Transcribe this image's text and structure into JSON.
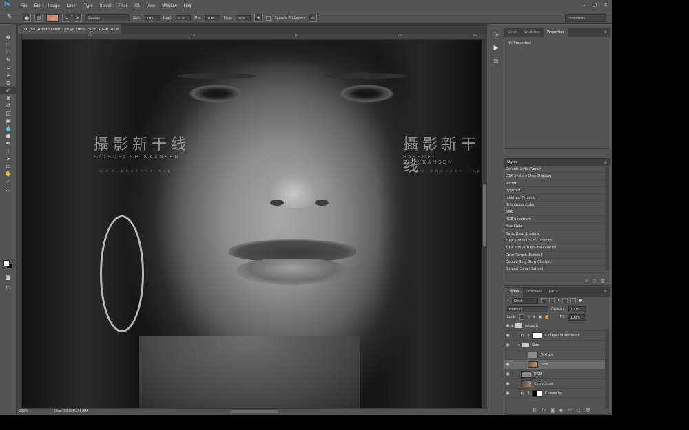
{
  "menubar": {
    "logo": "Ps",
    "items": [
      "File",
      "Edit",
      "Image",
      "Layer",
      "Type",
      "Select",
      "Filter",
      "3D",
      "View",
      "Window",
      "Help"
    ],
    "window_controls": [
      "–",
      "▢",
      "✕"
    ]
  },
  "options": {
    "preset": "Custom",
    "soft_label": "Soft:",
    "soft_value": "10%",
    "load_label": "Load:",
    "load_value": "10%",
    "mix_label": "Mix:",
    "mix_value": "10%",
    "flow_label": "Flow:",
    "flow_value": "10%",
    "sample_all_layers": "Sample All Layers",
    "workspace": "Essentials"
  },
  "document": {
    "tab_title": "DSC_8574-Mod-Filter 2.tif @ 200% (Skin, RGB/16) *",
    "tab_close": "×",
    "ruler_marks": [
      "20",
      "10",
      "10",
      "20",
      "60"
    ],
    "status_zoom": "200%",
    "status_doc": "Doc: 33.8M/136.8M"
  },
  "watermark": {
    "chinese": "攝影新干线",
    "english": "SATSUEI SHINKANSEN",
    "url": "www.photoss.vip"
  },
  "properties_panel": {
    "tabs": [
      "Color",
      "Swatches",
      "Properties"
    ],
    "active_tab": "Properties",
    "empty_text": "No Properties"
  },
  "styles_panel": {
    "title": "Styles",
    "items": [
      "Default Style (None)",
      "OSX System Drop Shadow",
      "Button",
      "Pyramid",
      "Inverted Pyramid",
      "Brightness Cube",
      "RGB",
      "RGB Spectrum",
      "Hue Cube",
      "Basic Drop Shadow",
      "1 Px Stroke 0% Fill Opacity",
      "1 Px Stroke 100% Fill Opacity",
      "Color Target (Button)",
      "Double Ring Glow (Button)",
      "Striped Cone (Button)"
    ]
  },
  "layers_panel": {
    "tabs": [
      "Layers",
      "Channels",
      "Paths"
    ],
    "active_tab": "Layers",
    "filter_kind": "Kind",
    "blend_mode": "Normal",
    "opacity_label": "Opacity:",
    "opacity_value": "100%",
    "lock_label": "Lock:",
    "fill_label": "Fill:",
    "fill_value": "100%",
    "layers": [
      {
        "name": "retouch",
        "type": "group",
        "indent": 0
      },
      {
        "name": "Channel Mixer mask",
        "type": "adjustment",
        "indent": 1
      },
      {
        "name": "Skin",
        "type": "group",
        "indent": 1
      },
      {
        "name": "Texture",
        "type": "pixel-gray",
        "indent": 2
      },
      {
        "name": "Skin",
        "type": "pixel-face",
        "indent": 2,
        "selected": true
      },
      {
        "name": "D&B",
        "type": "pixel-gray",
        "indent": 1
      },
      {
        "name": "Corrections",
        "type": "pixel-face",
        "indent": 1
      },
      {
        "name": "Curves bg",
        "type": "adjustment",
        "indent": 1
      }
    ],
    "footer_icons": [
      "link",
      "fx",
      "mask",
      "adjust",
      "folder",
      "new",
      "trash"
    ]
  },
  "tools": [
    "move",
    "marquee",
    "lasso",
    "quick-select",
    "crop",
    "eyedropper",
    "healing",
    "brush",
    "stamp",
    "history-brush",
    "eraser",
    "gradient",
    "blur",
    "dodge",
    "pen",
    "type",
    "path-select",
    "rectangle",
    "hand",
    "zoom",
    "more"
  ]
}
